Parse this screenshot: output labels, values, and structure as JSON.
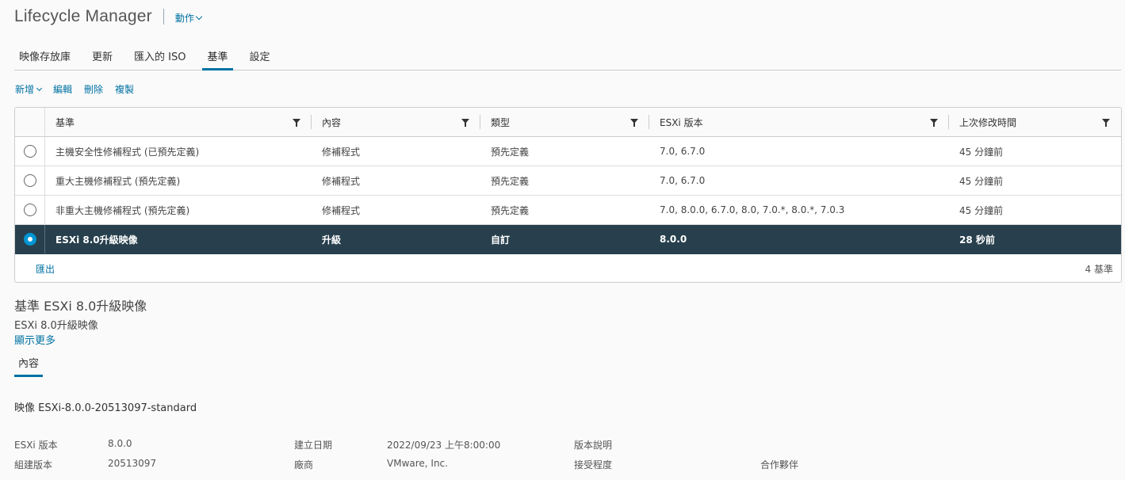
{
  "header": {
    "title": "Lifecycle Manager",
    "actions_label": "動作"
  },
  "tabs": [
    {
      "label": "映像存放庫"
    },
    {
      "label": "更新"
    },
    {
      "label": "匯入的 ISO"
    },
    {
      "label": "基準",
      "active": true
    },
    {
      "label": "設定"
    }
  ],
  "toolbar": {
    "new_label": "新增",
    "edit_label": "編輯",
    "delete_label": "刪除",
    "copy_label": "複製"
  },
  "grid": {
    "columns": [
      "基準",
      "內容",
      "類型",
      "ESXi 版本",
      "上次修改時間"
    ],
    "rows": [
      {
        "name": "主機安全性修補程式 (已預先定義)",
        "content": "修補程式",
        "type": "預先定義",
        "esxi": "7.0, 6.7.0",
        "modified": "45 分鐘前",
        "selected": false
      },
      {
        "name": "重大主機修補程式 (預先定義)",
        "content": "修補程式",
        "type": "預先定義",
        "esxi": "7.0, 6.7.0",
        "modified": "45 分鐘前",
        "selected": false
      },
      {
        "name": "非重大主機修補程式 (預先定義)",
        "content": "修補程式",
        "type": "預先定義",
        "esxi": "7.0, 8.0.0, 6.7.0, 8.0, 7.0.*, 8.0.*, 7.0.3",
        "modified": "45 分鐘前",
        "selected": false
      },
      {
        "name": "ESXi 8.0升級映像",
        "content": "升級",
        "type": "自訂",
        "esxi": "8.0.0",
        "modified": "28 秒前",
        "selected": true
      }
    ],
    "export_label": "匯出",
    "count_label": "4 基準"
  },
  "detail": {
    "title": "基準 ESXi 8.0升級映像",
    "description": "ESXi 8.0升級映像",
    "show_more": "顯示更多",
    "subtab": "內容",
    "image_name": "映像 ESXi-8.0.0-20513097-standard",
    "fields": {
      "esxi_version_label": "ESXi 版本",
      "esxi_version_value": "8.0.0",
      "build_label": "組建版本",
      "build_value": "20513097",
      "created_label": "建立日期",
      "created_value": "2022/09/23 上午8:00:00",
      "vendor_label": "廠商",
      "vendor_value": "VMware, Inc.",
      "release_notes_label": "版本說明",
      "acceptance_label": "接受程度",
      "acceptance_value": "合作夥伴"
    }
  },
  "colors": {
    "accent": "#0072a3",
    "selected_row": "#28404d",
    "radio_on": "#0095d3"
  }
}
